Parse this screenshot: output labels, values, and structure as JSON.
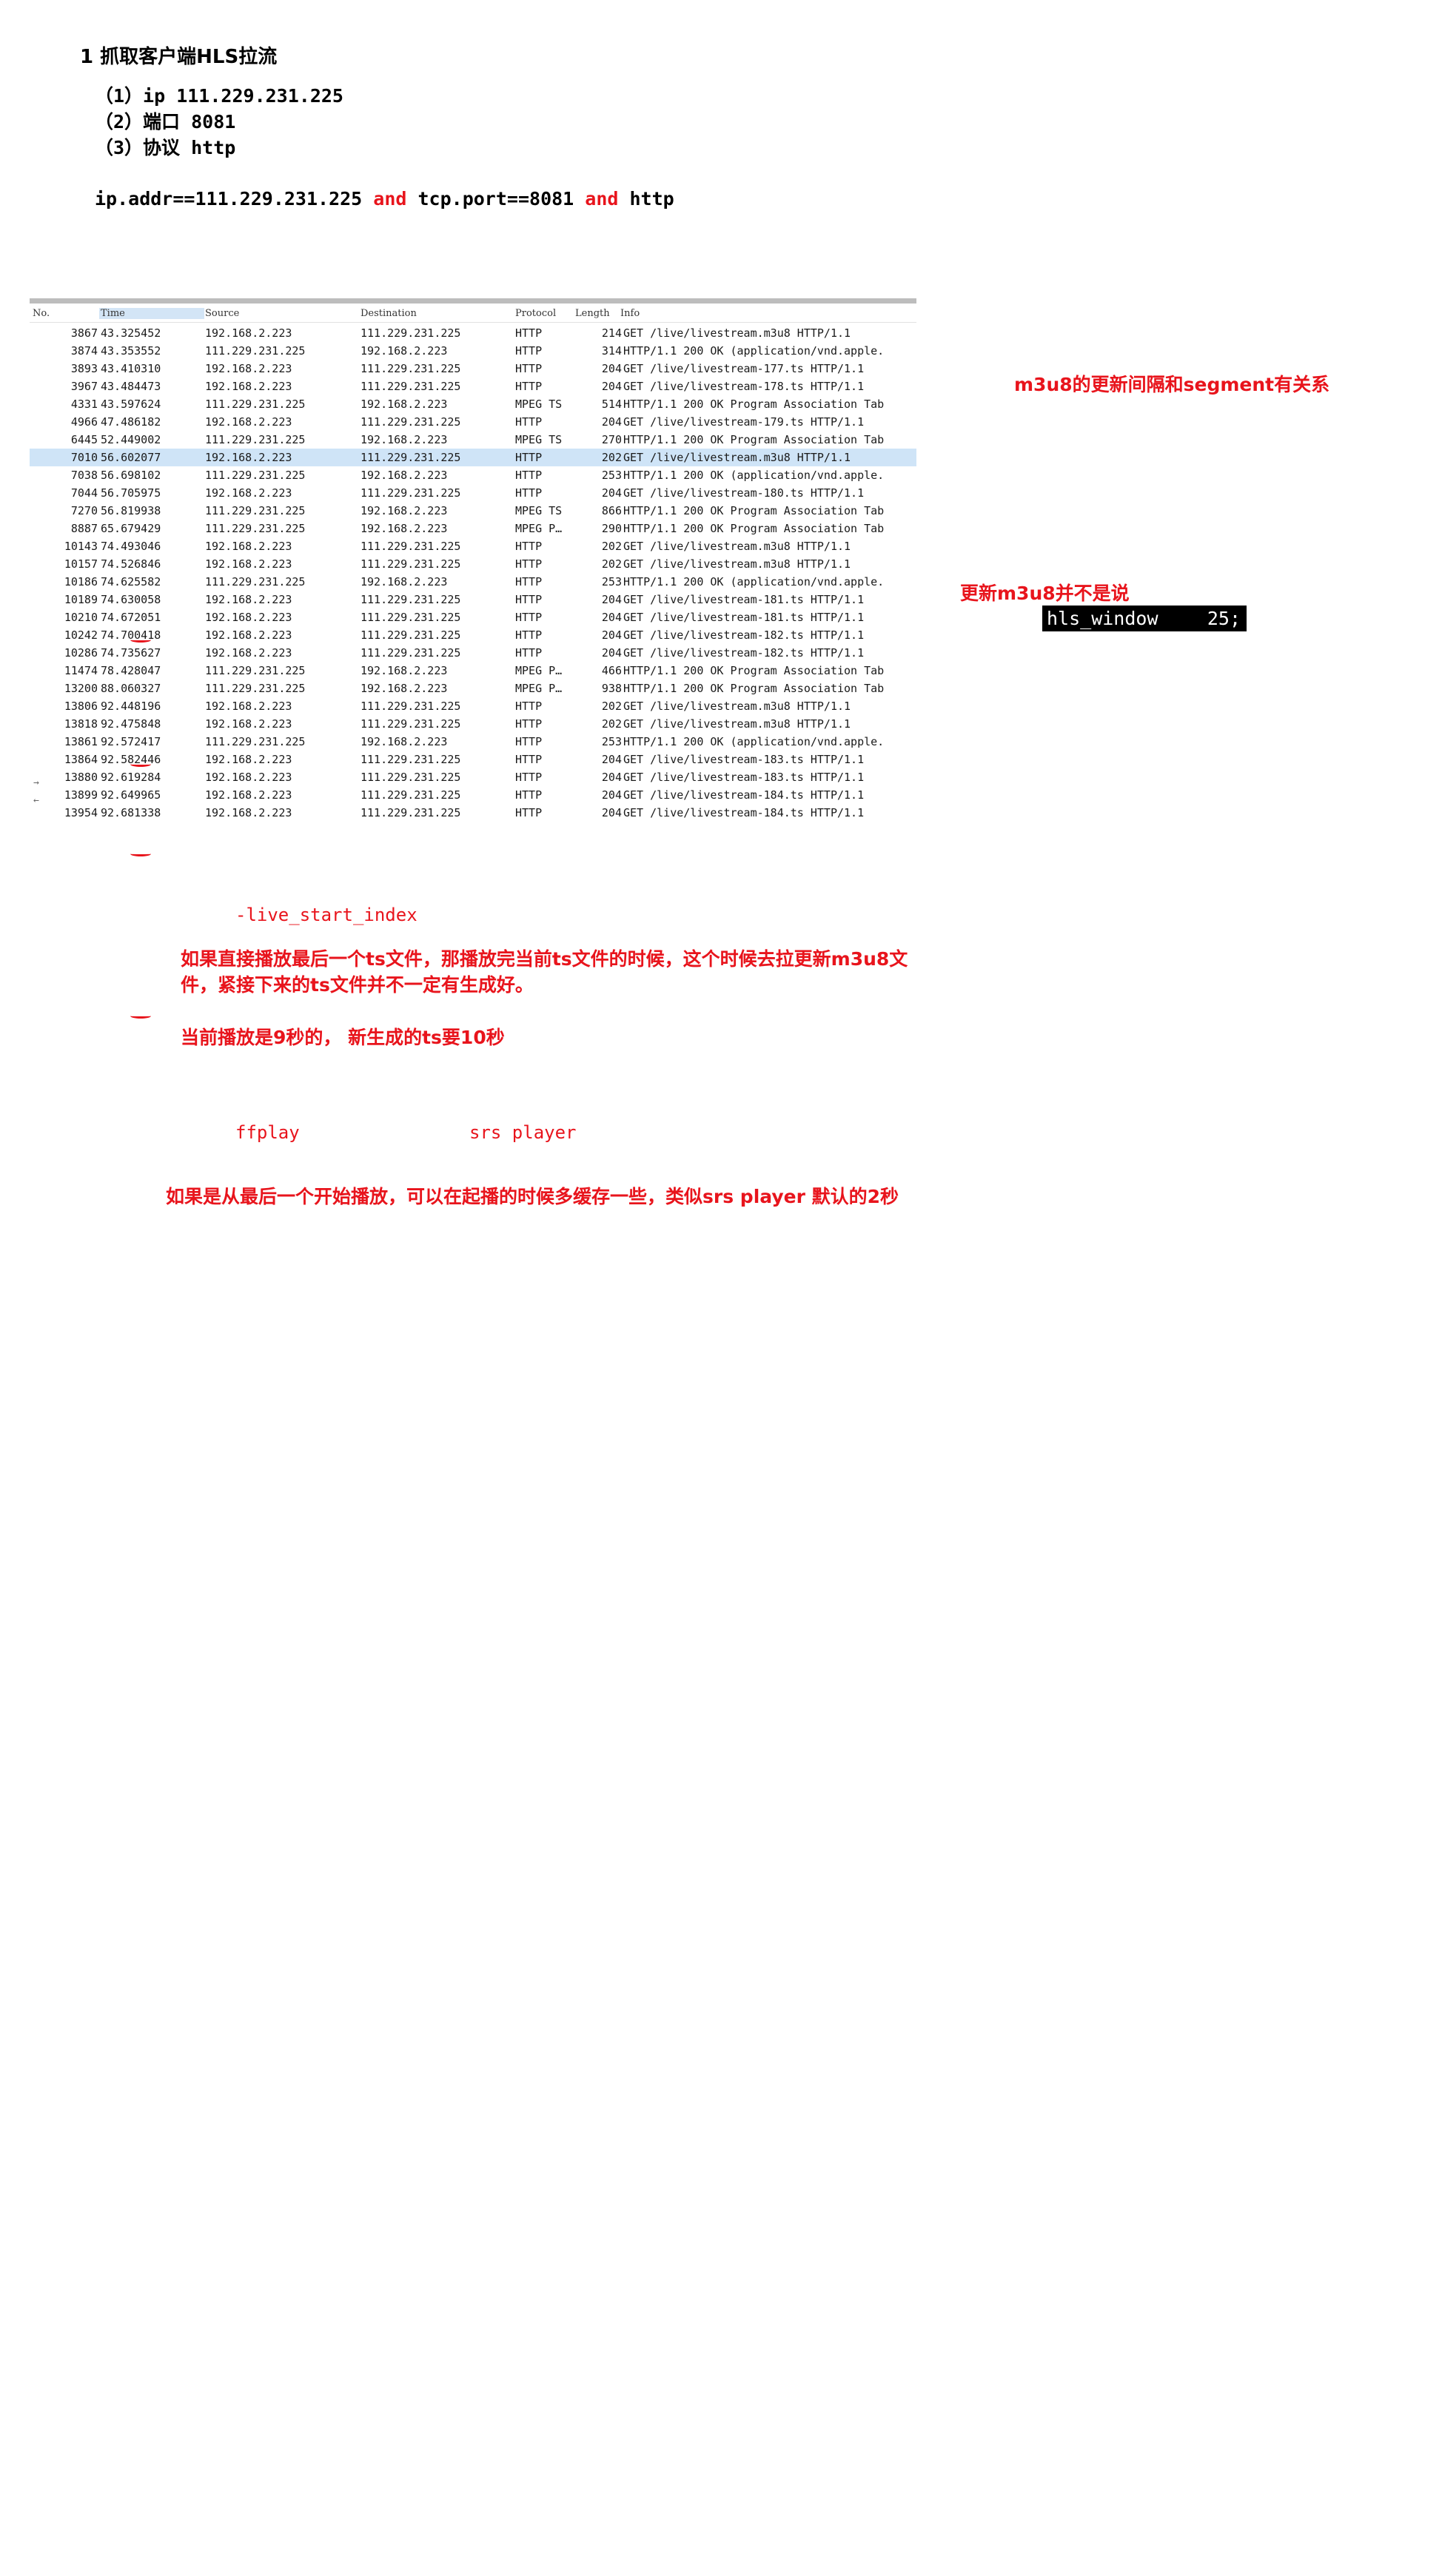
{
  "heading": "1 抓取客户端HLS拉流",
  "items": [
    "（1）ip 111.229.231.225",
    "（2）端口 8081",
    "（3）协议 http"
  ],
  "filter": {
    "part1": "ip.addr==111.229.231.225 ",
    "kw1": "and",
    "part2": " tcp.port==8081 ",
    "kw2": "and",
    "part3": " http"
  },
  "packet_list": {
    "columns": {
      "no": "No.",
      "time": "Time",
      "source": "Source",
      "destination": "Destination",
      "protocol": "Protocol",
      "length": "Length",
      "info": "Info"
    },
    "selected_row": 7,
    "rows": [
      {
        "no": "3867",
        "time": "43.325452",
        "source": "192.168.2.223",
        "destination": "111.229.231.225",
        "protocol": "HTTP",
        "length": "214",
        "info": "GET /live/livestream.m3u8 HTTP/1.1"
      },
      {
        "no": "3874",
        "time": "43.353552",
        "source": "111.229.231.225",
        "destination": "192.168.2.223",
        "protocol": "HTTP",
        "length": "314",
        "info": "HTTP/1.1 200 OK  (application/vnd.apple."
      },
      {
        "no": "3893",
        "time": "43.410310",
        "source": "192.168.2.223",
        "destination": "111.229.231.225",
        "protocol": "HTTP",
        "length": "204",
        "info": "GET /live/livestream-177.ts HTTP/1.1"
      },
      {
        "no": "3967",
        "time": "43.484473",
        "source": "192.168.2.223",
        "destination": "111.229.231.225",
        "protocol": "HTTP",
        "length": "204",
        "info": "GET /live/livestream-178.ts HTTP/1.1"
      },
      {
        "no": "4331",
        "time": "43.597624",
        "source": "111.229.231.225",
        "destination": "192.168.2.223",
        "protocol": "MPEG TS",
        "length": "514",
        "info": "HTTP/1.1 200 OK  Program Association Tab"
      },
      {
        "no": "4966",
        "time": "47.486182",
        "source": "192.168.2.223",
        "destination": "111.229.231.225",
        "protocol": "HTTP",
        "length": "204",
        "info": "GET /live/livestream-179.ts HTTP/1.1"
      },
      {
        "no": "6445",
        "time": "52.449002",
        "source": "111.229.231.225",
        "destination": "192.168.2.223",
        "protocol": "MPEG TS",
        "length": "270",
        "info": "HTTP/1.1 200 OK  Program Association Tab"
      },
      {
        "no": "7010",
        "time": "56.602077",
        "source": "192.168.2.223",
        "destination": "111.229.231.225",
        "protocol": "HTTP",
        "length": "202",
        "info": "GET /live/livestream.m3u8 HTTP/1.1"
      },
      {
        "no": "7038",
        "time": "56.698102",
        "source": "111.229.231.225",
        "destination": "192.168.2.223",
        "protocol": "HTTP",
        "length": "253",
        "info": "HTTP/1.1 200 OK  (application/vnd.apple."
      },
      {
        "no": "7044",
        "time": "56.705975",
        "source": "192.168.2.223",
        "destination": "111.229.231.225",
        "protocol": "HTTP",
        "length": "204",
        "info": "GET /live/livestream-180.ts HTTP/1.1"
      },
      {
        "no": "7270",
        "time": "56.819938",
        "source": "111.229.231.225",
        "destination": "192.168.2.223",
        "protocol": "MPEG TS",
        "length": "866",
        "info": "HTTP/1.1 200 OK  Program Association Tab"
      },
      {
        "no": "8887",
        "time": "65.679429",
        "source": "111.229.231.225",
        "destination": "192.168.2.223",
        "protocol": "MPEG P…",
        "length": "290",
        "info": "HTTP/1.1 200 OK  Program Association Tab"
      },
      {
        "no": "10143",
        "time": "74.493046",
        "source": "192.168.2.223",
        "destination": "111.229.231.225",
        "protocol": "HTTP",
        "length": "202",
        "info": "GET /live/livestream.m3u8 HTTP/1.1"
      },
      {
        "no": "10157",
        "time": "74.526846",
        "source": "192.168.2.223",
        "destination": "111.229.231.225",
        "protocol": "HTTP",
        "length": "202",
        "info": "GET /live/livestream.m3u8 HTTP/1.1"
      },
      {
        "no": "10186",
        "time": "74.625582",
        "source": "111.229.231.225",
        "destination": "192.168.2.223",
        "protocol": "HTTP",
        "length": "253",
        "info": "HTTP/1.1 200 OK  (application/vnd.apple."
      },
      {
        "no": "10189",
        "time": "74.630058",
        "source": "192.168.2.223",
        "destination": "111.229.231.225",
        "protocol": "HTTP",
        "length": "204",
        "info": "GET /live/livestream-181.ts HTTP/1.1"
      },
      {
        "no": "10210",
        "time": "74.672051",
        "source": "192.168.2.223",
        "destination": "111.229.231.225",
        "protocol": "HTTP",
        "length": "204",
        "info": "GET /live/livestream-181.ts HTTP/1.1"
      },
      {
        "no": "10242",
        "time": "74.700418",
        "source": "192.168.2.223",
        "destination": "111.229.231.225",
        "protocol": "HTTP",
        "length": "204",
        "info": "GET /live/livestream-182.ts HTTP/1.1"
      },
      {
        "no": "10286",
        "time": "74.735627",
        "source": "192.168.2.223",
        "destination": "111.229.231.225",
        "protocol": "HTTP",
        "length": "204",
        "info": "GET /live/livestream-182.ts HTTP/1.1"
      },
      {
        "no": "11474",
        "time": "78.428047",
        "source": "111.229.231.225",
        "destination": "192.168.2.223",
        "protocol": "MPEG P…",
        "length": "466",
        "info": "HTTP/1.1 200 OK  Program Association Tab"
      },
      {
        "no": "13200",
        "time": "88.060327",
        "source": "111.229.231.225",
        "destination": "192.168.2.223",
        "protocol": "MPEG P…",
        "length": "938",
        "info": "HTTP/1.1 200 OK  Program Association Tab"
      },
      {
        "no": "13806",
        "time": "92.448196",
        "source": "192.168.2.223",
        "destination": "111.229.231.225",
        "protocol": "HTTP",
        "length": "202",
        "info": "GET /live/livestream.m3u8 HTTP/1.1"
      },
      {
        "no": "13818",
        "time": "92.475848",
        "source": "192.168.2.223",
        "destination": "111.229.231.225",
        "protocol": "HTTP",
        "length": "202",
        "info": "GET /live/livestream.m3u8 HTTP/1.1"
      },
      {
        "no": "13861",
        "time": "92.572417",
        "source": "111.229.231.225",
        "destination": "192.168.2.223",
        "protocol": "HTTP",
        "length": "253",
        "info": "HTTP/1.1 200 OK  (application/vnd.apple."
      },
      {
        "no": "13864",
        "time": "92.582446",
        "source": "192.168.2.223",
        "destination": "111.229.231.225",
        "protocol": "HTTP",
        "length": "204",
        "info": "GET /live/livestream-183.ts HTTP/1.1"
      },
      {
        "no": "13880",
        "time": "92.619284",
        "source": "192.168.2.223",
        "destination": "111.229.231.225",
        "protocol": "HTTP",
        "length": "204",
        "info": "GET /live/livestream-183.ts HTTP/1.1"
      },
      {
        "no": "13899",
        "time": "92.649965",
        "source": "192.168.2.223",
        "destination": "111.229.231.225",
        "protocol": "HTTP",
        "length": "204",
        "info": "GET /live/livestream-184.ts HTTP/1.1"
      },
      {
        "no": "13954",
        "time": "92.681338",
        "source": "192.168.2.223",
        "destination": "111.229.231.225",
        "protocol": "HTTP",
        "length": "204",
        "info": "GET /live/livestream-184.ts HTTP/1.1"
      }
    ]
  },
  "notes": {
    "m3u8_interval": "m3u8的更新间隔和segment有关系",
    "m3u8_update": "更新m3u8并不是说",
    "hls_window_key": "hls_window",
    "hls_window_value": "25;",
    "live_start_index": "-live_start_index",
    "para1_line1": "如果直接播放最后一个ts文件，那播放完当前ts文件的时候，这个时候去拉更新m3u8文",
    "para1_line2": "件，紧接下来的ts文件并不一定有生成好。",
    "para2": "当前播放是9秒的， 新生成的ts要10秒",
    "ffplay": "ffplay",
    "srs_player": "srs player",
    "para3": "如果是从最后一个开始播放，可以在起播的时候多缓存一些，类似srs player 默认的2秒"
  },
  "colors": {
    "accent_red": "#e8141c",
    "selected_row": "#cfe4f7",
    "time_header": "#d3e5f6"
  }
}
